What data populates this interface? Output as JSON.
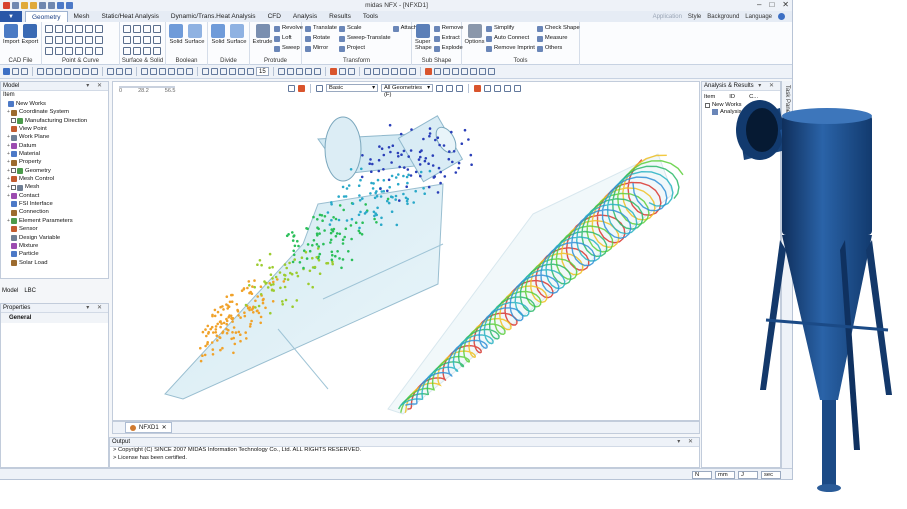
{
  "window": {
    "title": "midas NFX - [NFXD1]",
    "controls": [
      "–",
      "□",
      "✕"
    ]
  },
  "menu": {
    "app_button": "▼",
    "tabs": [
      "Geometry",
      "Mesh",
      "Static/Heat Analysis",
      "Dynamic/Trans.Heat Analysis",
      "CFD",
      "Analysis",
      "Results",
      "Tools"
    ],
    "right_items": [
      "Application",
      "Style",
      "Background",
      "Language"
    ]
  },
  "ribbon": {
    "groups": [
      {
        "name": "CAD File",
        "buttons": [
          "Import",
          "Export"
        ]
      },
      {
        "name": "Point & Curve",
        "buttons": []
      },
      {
        "name": "Surface & Solid",
        "buttons": []
      },
      {
        "name": "Boolean",
        "buttons": [
          "Solid",
          "Surface"
        ]
      },
      {
        "name": "Divide",
        "buttons": [
          "Solid",
          "Surface"
        ]
      },
      {
        "name": "Protrude",
        "buttons": [
          "Extrude"
        ],
        "list": [
          "Revolve",
          "Loft",
          "Sweep"
        ]
      },
      {
        "name": "Transform",
        "list": [
          "Translate",
          "Rotate",
          "Mirror",
          "Scale",
          "Sweep-Translate",
          "Project",
          "Attach"
        ]
      },
      {
        "name": "Sub Shape",
        "buttons": [
          "Super Shape"
        ],
        "list": [
          "Remove",
          "Extract",
          "Explode"
        ]
      },
      {
        "name": "Tools",
        "buttons": [
          "Options"
        ],
        "list": [
          "Simplify",
          "Auto Connect",
          "Remove Imprint",
          "Check Shape",
          "Measure",
          "Others"
        ]
      }
    ]
  },
  "toolbar": {
    "zoom_value": "15"
  },
  "model_panel": {
    "title": "Model",
    "header": "Item",
    "items": [
      {
        "label": "New Works",
        "level": 0,
        "exp": "",
        "check": false
      },
      {
        "label": "Coordinate System",
        "level": 1,
        "exp": "+",
        "check": false
      },
      {
        "label": "Manufacturing Direction",
        "level": 1,
        "exp": "",
        "check": true
      },
      {
        "label": "View Point",
        "level": 1,
        "exp": "",
        "check": false
      },
      {
        "label": "Work Plane",
        "level": 1,
        "exp": "+",
        "check": false
      },
      {
        "label": "Datum",
        "level": 1,
        "exp": "+",
        "check": false
      },
      {
        "label": "Material",
        "level": 1,
        "exp": "+",
        "check": false
      },
      {
        "label": "Property",
        "level": 1,
        "exp": "+",
        "check": false
      },
      {
        "label": "Geometry",
        "level": 1,
        "exp": "+",
        "check": true
      },
      {
        "label": "Mesh Control",
        "level": 1,
        "exp": "+",
        "check": false
      },
      {
        "label": "Mesh",
        "level": 1,
        "exp": "+",
        "check": true
      },
      {
        "label": "Contact",
        "level": 1,
        "exp": "+",
        "check": false
      },
      {
        "label": "FSI Interface",
        "level": 1,
        "exp": "",
        "check": false
      },
      {
        "label": "Connection",
        "level": 1,
        "exp": "",
        "check": false
      },
      {
        "label": "Element Parameters",
        "level": 1,
        "exp": "+",
        "check": false
      },
      {
        "label": "Sensor",
        "level": 1,
        "exp": "",
        "check": false
      },
      {
        "label": "Design Variable",
        "level": 1,
        "exp": "",
        "check": false
      },
      {
        "label": "Mixture",
        "level": 1,
        "exp": "",
        "check": false
      },
      {
        "label": "Particle",
        "level": 1,
        "exp": "",
        "check": false
      },
      {
        "label": "Solar Load",
        "level": 1,
        "exp": "",
        "check": false
      }
    ],
    "bottom_tabs": [
      "Model",
      "LBC"
    ]
  },
  "properties_panel": {
    "title": "Properties",
    "section": "General"
  },
  "viewport": {
    "ruler_labels": [
      "0",
      "28.2",
      "56.5"
    ],
    "view_style": "Basic",
    "geometry_filter": "All Geometries (F)",
    "doc_tab": "NFXD1"
  },
  "output_panel": {
    "title": "Output",
    "lines": [
      "> Copyright (C) SINCE 2007 MIDAS Information Technology Co., Ltd. ALL RIGHTS RESERVED.",
      "> License has been certified."
    ]
  },
  "status_bar": {
    "units": [
      "N",
      "mm",
      "J",
      "sec"
    ]
  },
  "analysis_panel": {
    "title": "Analysis & Results",
    "header": "Item",
    "columns": [
      "ID",
      "C..."
    ],
    "items": [
      "New Works",
      "Analysis"
    ]
  },
  "task_pane": {
    "label": "Task Pane"
  },
  "colors": {
    "accent": "#2a57a8",
    "cyclone_body": "#1d4f8f"
  }
}
